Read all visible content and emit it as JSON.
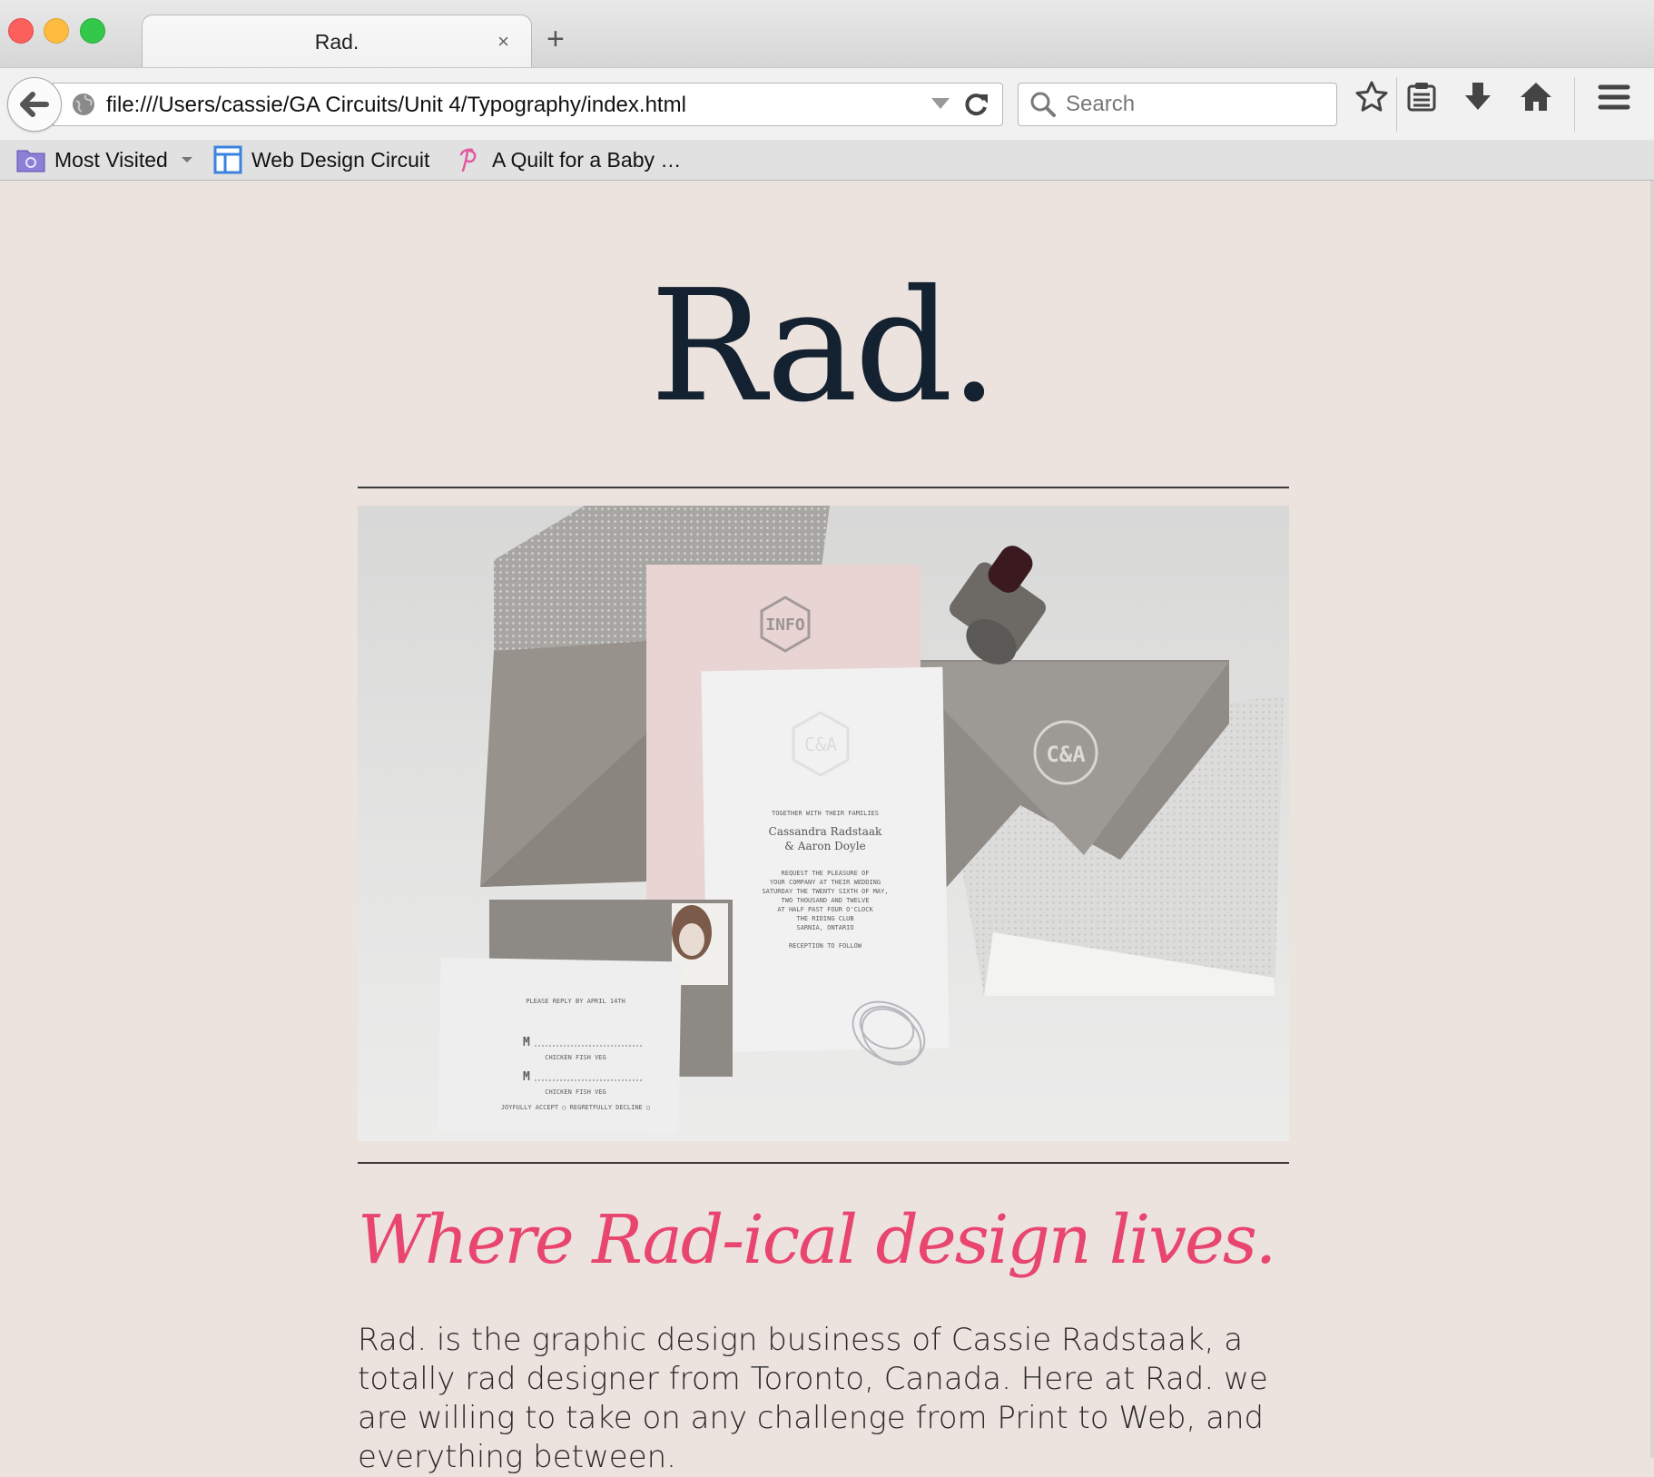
{
  "browser": {
    "tab_title": "Rad.",
    "tab_close": "×",
    "new_tab": "+",
    "url": "file:///Users/cassie/GA Circuits/Unit 4/Typography/index.html",
    "search_placeholder": "Search",
    "bookmarks": [
      {
        "label": "Most Visited",
        "icon": "folder-icon"
      },
      {
        "label": "Web Design Circuit",
        "icon": "layout-icon"
      },
      {
        "label": "A Quilt for a Baby …",
        "icon": "pinterest-icon"
      }
    ],
    "toolbar_icons": [
      "star-icon",
      "reading-list-icon",
      "download-icon",
      "home-icon",
      "menu-icon"
    ]
  },
  "page": {
    "logo": "Rad.",
    "hero_image": {
      "texts": {
        "info": "INFO",
        "monogram": "C&A",
        "together": "TOGETHER WITH THEIR FAMILIES",
        "names1": "Cassandra Radstaak",
        "names2": "& Aaron Doyle",
        "request": "REQUEST THE PLEASURE OF",
        "company": "YOUR COMPANY AT THEIR WEDDING",
        "date": "SATURDAY THE TWENTY SIXTH OF MAY,",
        "year": "TWO THOUSAND AND TWELVE",
        "time": "AT HALF PAST FOUR O'CLOCK",
        "venue": "THE RIDING CLUB",
        "city": "SARNIA, ONTARIO",
        "reception": "RECEPTION TO FOLLOW",
        "rsvp": "PLEASE REPLY BY APRIL 14TH",
        "m": "M",
        "choices": "CHICKEN   FISH   VEG",
        "accept": "JOYFULLY ACCEPT ○  REGRETFULLY DECLINE ○"
      }
    },
    "tagline": "Where Rad-ical design lives.",
    "intro": "Rad. is the graphic design business of Cassie Radstaak, a totally rad designer from Toronto, Canada. Here at Rad. we are willing to take on any challenge from Print to Web, and everything between."
  },
  "colors": {
    "page_bg": "#ece2de",
    "logo": "#142131",
    "tagline": "#e8456f"
  }
}
